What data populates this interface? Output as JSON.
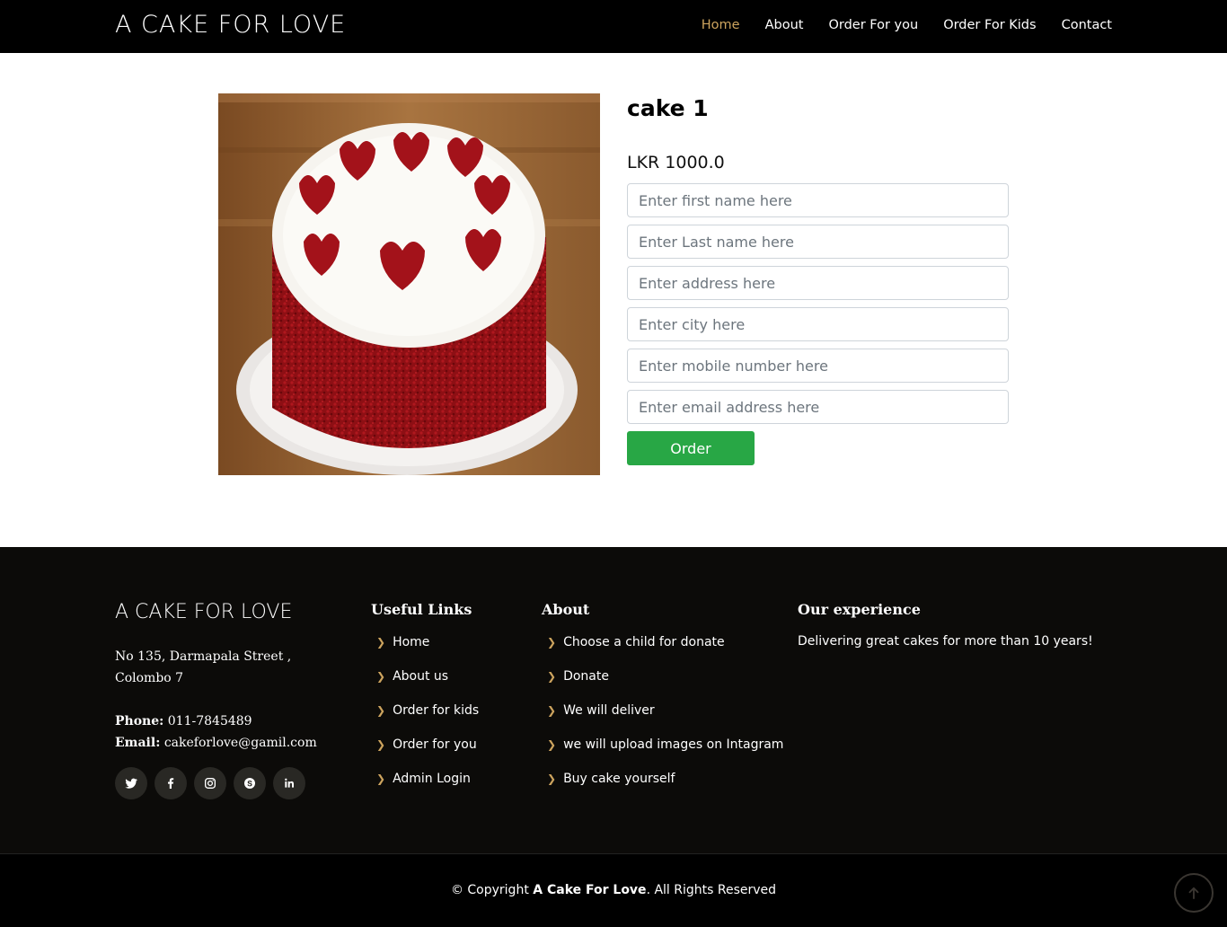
{
  "header": {
    "logo": "A CAKE FOR LOVE",
    "nav": [
      {
        "label": "Home",
        "active": true
      },
      {
        "label": "About"
      },
      {
        "label": "Order For you"
      },
      {
        "label": "Order For Kids"
      },
      {
        "label": "Contact"
      }
    ]
  },
  "product": {
    "title": "cake 1",
    "price": "LKR 1000.0",
    "image_alt": "red velvet cake with heart decorations"
  },
  "form": {
    "first_name_placeholder": "Enter first name here",
    "last_name_placeholder": "Enter Last name here",
    "address_placeholder": "Enter address here",
    "city_placeholder": "Enter city here",
    "mobile_placeholder": "Enter mobile number here",
    "email_placeholder": "Enter email address here",
    "submit_label": "Order"
  },
  "footer": {
    "brand": "A CAKE FOR LOVE",
    "address_line1": "No 135, Darmapala Street ,",
    "address_line2": "Colombo 7",
    "phone_label": "Phone:",
    "phone": "011-7845489",
    "email_label": "Email:",
    "email": "cakeforlove@gamil.com",
    "social_icons": [
      "twitter-icon",
      "facebook-icon",
      "instagram-icon",
      "skype-icon",
      "linkedin-icon"
    ],
    "useful_links": {
      "heading": "Useful Links",
      "items": [
        "Home",
        "About us",
        "Order for kids",
        "Order for you",
        "Admin Login"
      ]
    },
    "about": {
      "heading": "About",
      "items": [
        "Choose a child for donate",
        "Donate",
        "We will deliver",
        "we will upload images on Intagram",
        "Buy cake yourself"
      ]
    },
    "experience": {
      "heading": "Our experience",
      "text": "Delivering great cakes for more than 10 years!"
    },
    "copyright_prefix": "© Copyright",
    "copyright_brand": "A Cake For Love",
    "copyright_suffix": ". All Rights Reserved"
  },
  "colors": {
    "accent": "#cda45e",
    "order_button": "#28a745",
    "header_bg": "#000000",
    "footer_bg": "#0c0b09"
  }
}
